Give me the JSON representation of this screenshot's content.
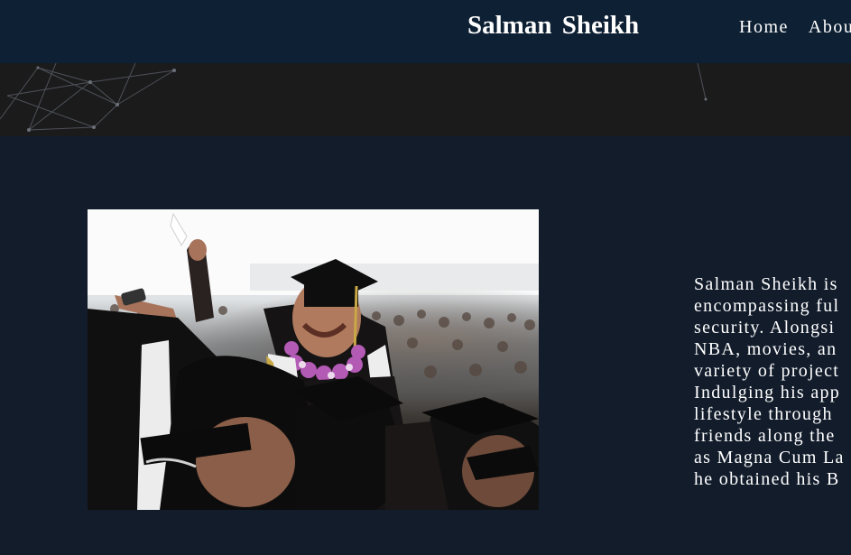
{
  "header": {
    "brand": "Salman Sheikh",
    "nav": [
      {
        "label": "Home"
      },
      {
        "label": "Abou"
      }
    ]
  },
  "about": {
    "bio_lines": [
      "Salman Sheikh is",
      "encompassing ful",
      "security. Alongsi",
      "NBA, movies, an",
      "variety of project",
      "Indulging his app",
      "lifestyle through",
      "friends along the",
      "as Magna Cum La",
      "he obtained his B"
    ]
  },
  "colors": {
    "navbar_bg": "#0e2033",
    "banner_bg": "#1b1b1c",
    "page_bg": "#121c2b",
    "text": "#ffffff"
  }
}
